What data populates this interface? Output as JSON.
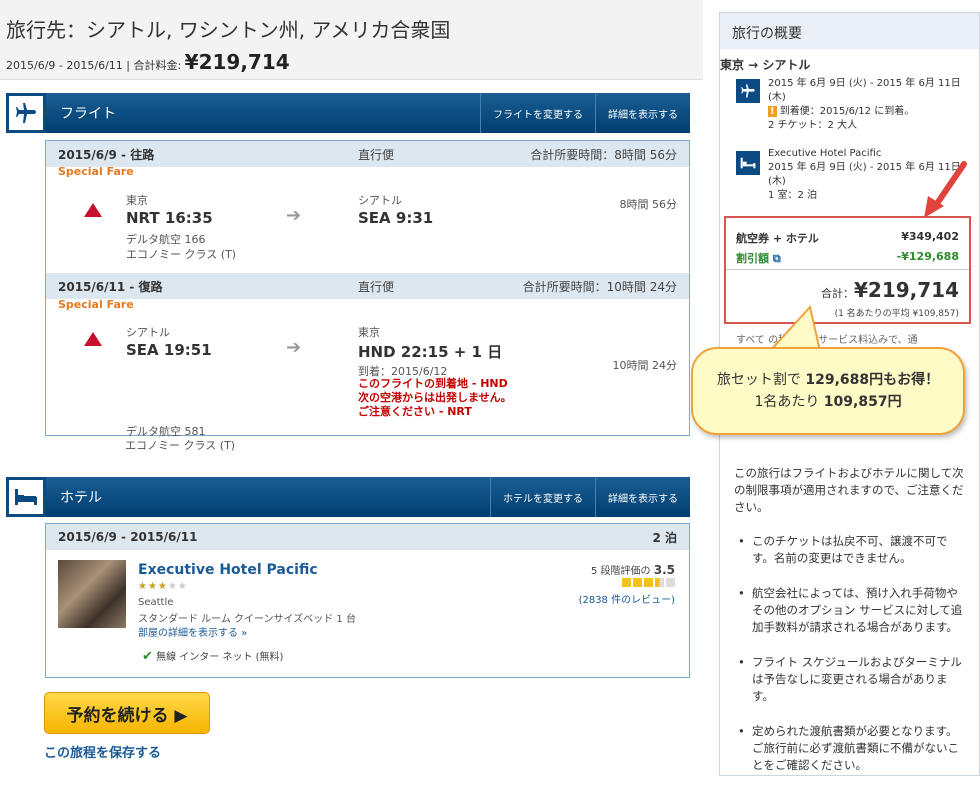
{
  "header": {
    "destination": "旅行先：シアトル, ワシントン州, アメリカ合衆国",
    "dates": "2015/6/9 - 2015/6/11 | 合計料金: ",
    "total": "¥219,714"
  },
  "flight_section": {
    "title": "フライト",
    "change_btn": "フライトを変更する",
    "details_btn": "詳細を表示する",
    "legs": [
      {
        "head_date": "2015/6/9 - 往路",
        "head_type": "直行便",
        "head_time": "合計所要時間：8時間 56分",
        "special": "Special Fare",
        "dep_city": "東京",
        "dep_code_time": "NRT 16:35",
        "arr_city": "シアトル",
        "arr_code_time": "SEA 9:31",
        "duration": "8時間 56分",
        "airline": "デルタ航空 166",
        "cabin": "エコノミー クラス (T)"
      },
      {
        "head_date": "2015/6/11 - 復路",
        "head_type": "直行便",
        "head_time": "合計所要時間：10時間 24分",
        "special": "Special Fare",
        "dep_city": "シアトル",
        "dep_code_time": "SEA 19:51",
        "arr_city": "東京",
        "arr_code_time": "HND 22:15 + 1 日",
        "arr_date": "到着：2015/6/12",
        "warning": "このフライトの到着地 - HND 次の空港からは出発しません。ご注意ください - NRT",
        "duration": "10時間 24分",
        "airline": "デルタ航空 581",
        "cabin": "エコノミー クラス (T)"
      }
    ]
  },
  "hotel_section": {
    "title": "ホテル",
    "change_btn": "ホテルを変更する",
    "details_btn": "詳細を表示する",
    "dates": "2015/6/9 - 2015/6/11",
    "nights": "2 泊",
    "name": "Executive Hotel Pacific",
    "city": "Seattle",
    "room": "スタンダード ルーム クイーンサイズベッド 1 台",
    "room_details": "部屋の詳細を表示する",
    "wifi": "無線 インター ネット (無料)",
    "rating_label": "5 段階評価の",
    "rating": "3.5",
    "reviews": "(2838 件のレビュー)",
    "stars": 3
  },
  "actions": {
    "continue": "予約を続ける ▶",
    "save": "この旅程を保存する"
  },
  "sidebar": {
    "title": "旅行の概要",
    "route": "東京 → シアトル",
    "flight_dates": "2015 年 6月 9日 (火) - 2015 年 6月 11日 (木)",
    "flight_arrival": "到着便：2015/6/12 に到着。",
    "flight_tickets": "2 チケット：2 大人",
    "hotel_name": "Executive Hotel Pacific",
    "hotel_dates": "2015 年 6月 9日 (火) - 2015 年 6月 11日 (木)",
    "hotel_rooms": "1 室：2 泊",
    "package_label": "航空券 + ホテル",
    "package_price": "¥349,402",
    "discount_label": "割引額",
    "discount_price": "-¥129,688",
    "total_label": "合計：",
    "total_price": "¥219,714",
    "per_person": "(1 名あたりの平均 ¥109,857)",
    "tax_note": "すべて の税およびサービス料込みで、通",
    "restriction_intro": "この旅行はフライトおよびホテルに関して次の制限事項が適用されますので、ご注意ください。",
    "bullets": [
      "このチケットは払戻不可、譲渡不可です。名前の変更はできません。",
      "航空会社によっては、預け入れ手荷物やその他のオプション サービスに対して追加手数料が請求される場合があります。",
      "フライト スケジュールおよびターミナルは予告なしに変更される場合があります。",
      "定められた渡航書類が必要となります。ご旅行前に必ず渡航書類に不備がないことをご確認ください。"
    ]
  },
  "callout": {
    "line1_pre": "旅セット割で ",
    "line1_amount": "129,688円もお得！",
    "line2_pre": "1名あたり ",
    "line2_amount": "109,857円"
  },
  "colors": {
    "header_blue": "#003d70",
    "special_orange": "#e87a1e",
    "warning_red": "#c40000",
    "discount_green": "#2e8b2e",
    "button_yellow": "#f7b500"
  }
}
